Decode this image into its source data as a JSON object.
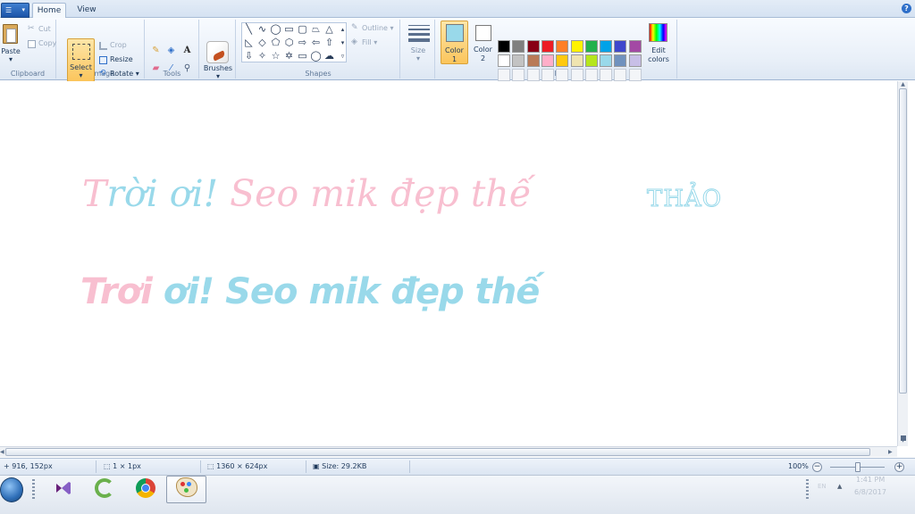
{
  "ribbon_tabs": {
    "home": "Home",
    "view": "View"
  },
  "clipboard": {
    "paste": "Paste",
    "cut": "Cut",
    "copy": "Copy",
    "group": "Clipboard"
  },
  "image": {
    "select": "Select",
    "crop": "Crop",
    "resize": "Resize",
    "rotate": "Rotate",
    "group": "Image"
  },
  "tools": {
    "group": "Tools",
    "text_tool_glyph": "A"
  },
  "brushes": {
    "label": "Brushes"
  },
  "shapes": {
    "group": "Shapes",
    "outline": "Outline",
    "fill": "Fill"
  },
  "size": {
    "label": "Size"
  },
  "colors": {
    "color1_label": "Color\n1",
    "color1_value": "#99d9ea",
    "color2_label": "Color\n2",
    "color2_value": "#ffffff",
    "edit_label": "Edit\ncolors",
    "group": "Colors",
    "palette_row1": [
      "#000000",
      "#7f7f7f",
      "#880015",
      "#ed1c24",
      "#ff7f27",
      "#fff200",
      "#22b14c",
      "#00a2e8",
      "#3f48cc",
      "#a349a4"
    ],
    "palette_row2": [
      "#ffffff",
      "#c3c3c3",
      "#b97a57",
      "#ffaec9",
      "#ffc90e",
      "#efe4b0",
      "#b5e61d",
      "#99d9ea",
      "#7092be",
      "#c8bfe7"
    ]
  },
  "canvas": {
    "line1_pink_a": "T",
    "line1_blue_a": "rời ơi! ",
    "line1_pink_b": "Seo mik đẹp thế",
    "line2_pink_a": "Trơi ",
    "line2_blue_a": "ơi! Seo mik đẹp thế",
    "signature": "THẢO"
  },
  "status": {
    "cursor": "916, 152px",
    "selection": "1 × 1px",
    "image_size": "1360 × 624px",
    "file_size": "Size: 29.2KB",
    "zoom": "100%"
  },
  "taskbar": {
    "apps": [
      "visual-studio",
      "camtasia",
      "chrome",
      "paint"
    ],
    "tray_time": "1:41 PM",
    "tray_date": "6/8/2017",
    "tray_lang": "EN"
  }
}
